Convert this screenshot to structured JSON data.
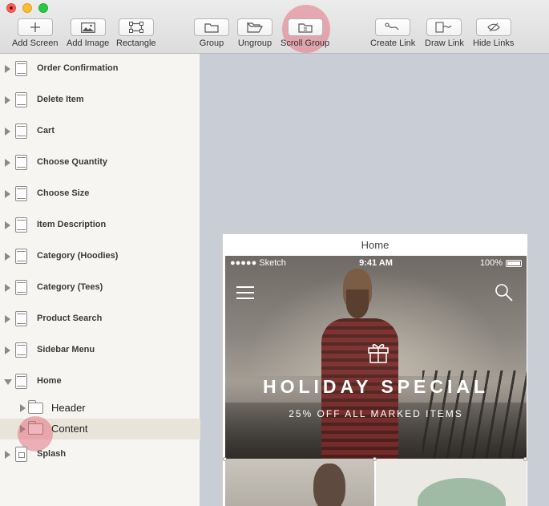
{
  "toolbar": {
    "buttons": [
      {
        "label": "Add Screen",
        "icon": "plus-icon"
      },
      {
        "label": "Add Image",
        "icon": "image-icon"
      },
      {
        "label": "Rectangle",
        "icon": "rectangle-icon"
      },
      {
        "label": "Group",
        "icon": "folder-icon"
      },
      {
        "label": "Ungroup",
        "icon": "open-folder-icon"
      },
      {
        "label": "Scroll Group",
        "icon": "scroll-group-icon"
      },
      {
        "label": "Create Link",
        "icon": "link-icon"
      },
      {
        "label": "Draw Link",
        "icon": "draw-link-icon"
      },
      {
        "label": "Hide Links",
        "icon": "hide-links-icon"
      }
    ],
    "highlight_color": "#e25a6e"
  },
  "sidebar": {
    "items": [
      {
        "label": "Order Confirmation",
        "expanded": false
      },
      {
        "label": "Delete Item",
        "expanded": false
      },
      {
        "label": "Cart",
        "expanded": false
      },
      {
        "label": "Choose Quantity",
        "expanded": false
      },
      {
        "label": "Choose Size",
        "expanded": false
      },
      {
        "label": "Item Description",
        "expanded": false
      },
      {
        "label": "Category (Hoodies)",
        "expanded": false
      },
      {
        "label": "Category (Tees)",
        "expanded": false
      },
      {
        "label": "Product Search",
        "expanded": false
      },
      {
        "label": "Sidebar Menu",
        "expanded": false
      },
      {
        "label": "Home",
        "expanded": true
      },
      {
        "label": "Header",
        "expanded": false,
        "type": "group"
      },
      {
        "label": "Content",
        "expanded": false,
        "type": "group",
        "selected": true
      },
      {
        "label": "Splash",
        "expanded": false
      }
    ]
  },
  "artboard": {
    "title": "Home",
    "status_bar": {
      "carrier": "●●●●● Sketch",
      "time": "9:41 AM",
      "battery": "100%"
    },
    "hero": {
      "title": "HOLIDAY SPECIAL",
      "subtitle": "25% OFF ALL MARKED ITEMS"
    }
  }
}
